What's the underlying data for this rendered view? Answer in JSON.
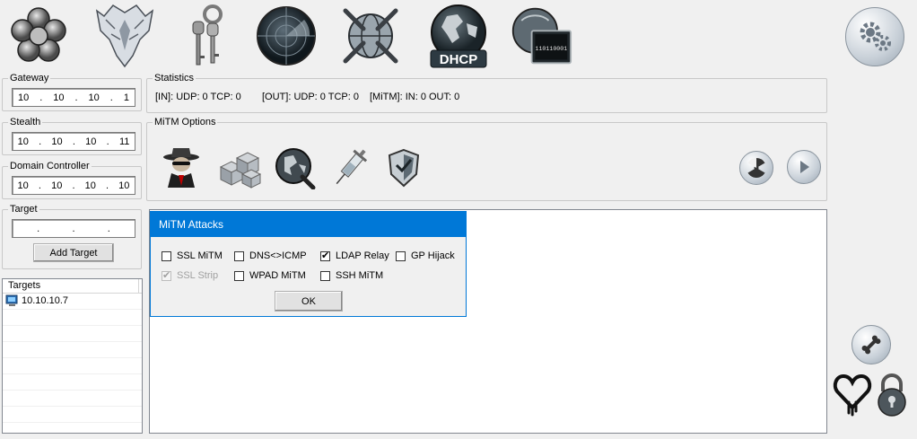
{
  "toolbar": {
    "icons": [
      "flower-icon",
      "eagle-icon",
      "keys-icon",
      "radar-icon",
      "network-globe-icon",
      "dhcp-globe-icon",
      "binary-monitor-icon"
    ],
    "dhcp_label": "DHCP",
    "binary_text": "110110001"
  },
  "settings_icon": "gear-icon",
  "gateway": {
    "title": "Gateway",
    "octets": [
      "10",
      "10",
      "10",
      "1"
    ]
  },
  "stealth": {
    "title": "Stealth",
    "octets": [
      "10",
      "10",
      "10",
      "11"
    ]
  },
  "domain_controller": {
    "title": "Domain Controller",
    "octets": [
      "10",
      "10",
      "10",
      "10"
    ]
  },
  "target": {
    "title": "Target",
    "octets": [
      "",
      "",
      "",
      ""
    ],
    "add_button": "Add Target"
  },
  "targets": {
    "header": "Targets",
    "rows": [
      "10.10.10.7",
      "",
      "",
      "",
      "",
      "",
      "",
      "",
      ""
    ]
  },
  "statistics": {
    "title": "Statistics",
    "in_text": "[IN]: UDP: 0 TCP: 0",
    "out_text": "[OUT]: UDP: 0 TCP: 0",
    "mitm_text": "[MiTM]: IN: 0 OUT: 0"
  },
  "mitm_options": {
    "title": "MiTM Options",
    "icons": [
      "spy-icon",
      "cubes-icon",
      "globe-search-icon",
      "syringe-icon",
      "shield-icon"
    ],
    "right_buttons": [
      "radiation-icon",
      "play-icon"
    ]
  },
  "dialog": {
    "title": "MiTM Attacks",
    "ok": "OK",
    "checkboxes": [
      {
        "label": "SSL MiTM",
        "checked": false,
        "disabled": false
      },
      {
        "label": "DNS<>ICMP",
        "checked": false,
        "disabled": false
      },
      {
        "label": "LDAP Relay",
        "checked": true,
        "disabled": false
      },
      {
        "label": "GP Hijack",
        "checked": false,
        "disabled": false
      },
      {
        "label": "SSL Strip",
        "checked": true,
        "disabled": true
      },
      {
        "label": "WPAD MiTM",
        "checked": false,
        "disabled": false
      },
      {
        "label": "SSH MiTM",
        "checked": false,
        "disabled": false
      }
    ]
  },
  "side_icons": [
    "bone-icon",
    "heartbleed-icon",
    "padlock-icon"
  ]
}
